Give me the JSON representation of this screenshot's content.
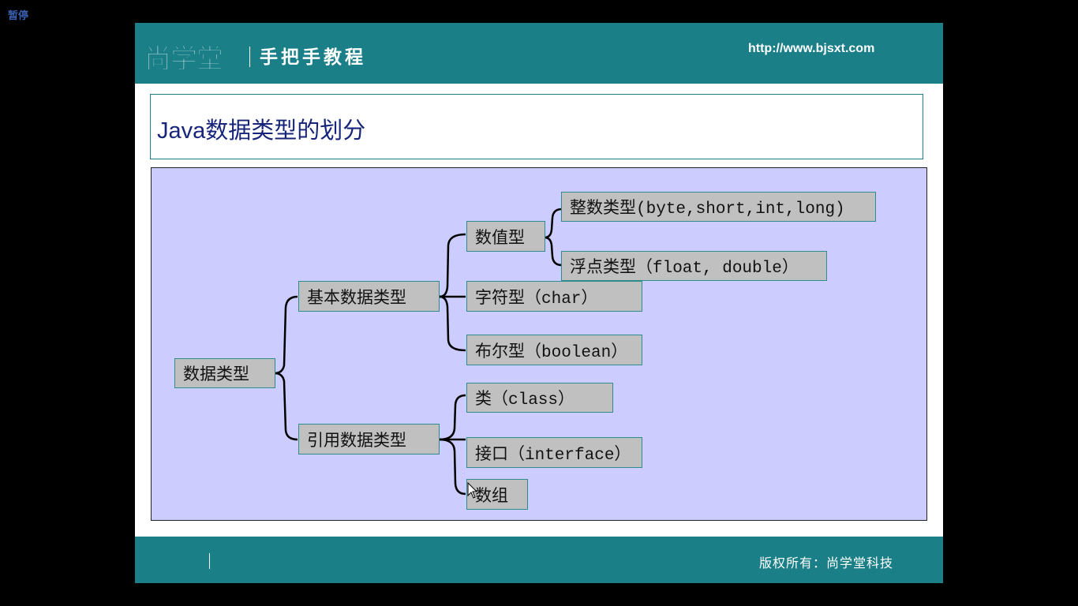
{
  "player": {
    "pause_label": "暂停"
  },
  "header": {
    "logo": "尚学堂",
    "subtitle": "手把手教程",
    "url": "http://www.bjsxt.com"
  },
  "slide": {
    "title": "Java数据类型的划分"
  },
  "diagram": {
    "root": "数据类型",
    "primitive": "基本数据类型",
    "numeric": "数值型",
    "integer": "整数类型(byte,short,int,long)",
    "float": "浮点类型（float, double）",
    "char": "字符型（char）",
    "boolean": "布尔型（boolean）",
    "reference": "引用数据类型",
    "class": "类（class）",
    "interface": "接口（interface）",
    "array": "数组"
  },
  "footer": {
    "copyright": "版权所有：尚学堂科技"
  },
  "colors": {
    "teal": "#1b7f88",
    "diagram_bg": "#ccccff",
    "node_bg": "#c0c0c0",
    "title": "#16257a"
  }
}
